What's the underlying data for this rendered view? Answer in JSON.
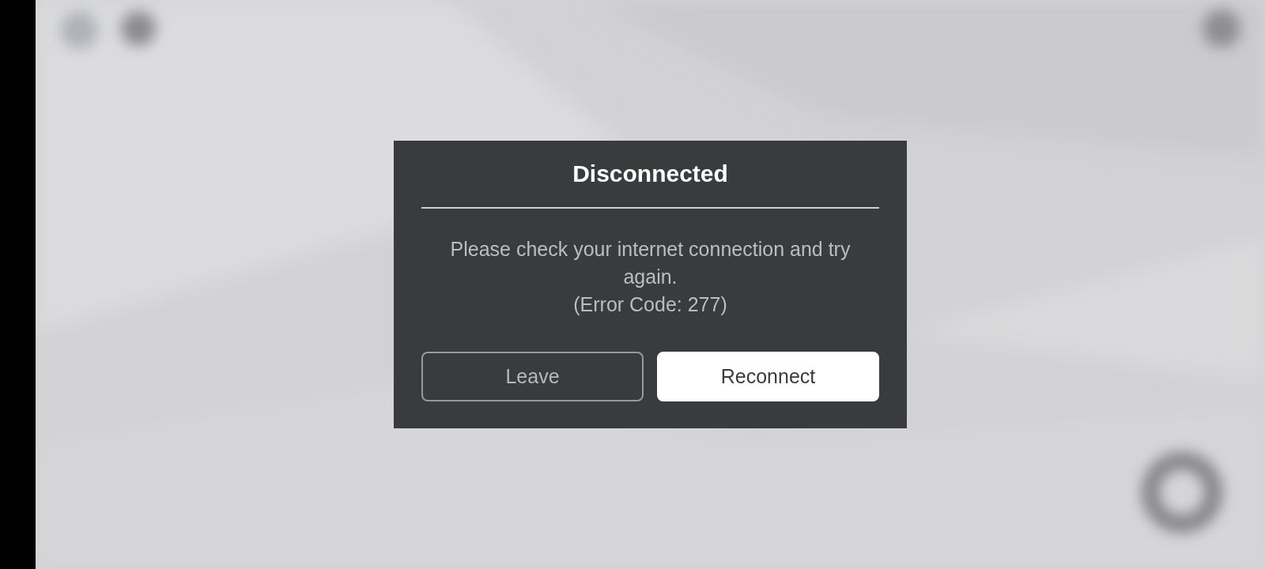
{
  "dialog": {
    "title": "Disconnected",
    "message": "Please check your internet connection and try again.",
    "error_code": "(Error Code: 277)",
    "buttons": [
      {
        "label": "Leave",
        "kind": "secondary"
      },
      {
        "label": "Reconnect",
        "kind": "primary"
      }
    ]
  }
}
